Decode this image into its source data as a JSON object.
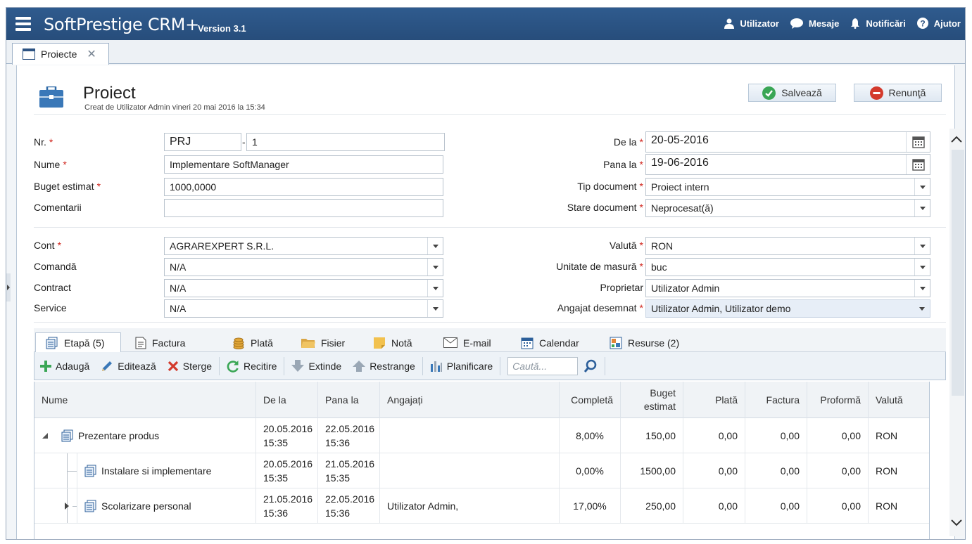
{
  "app": {
    "title": "SoftPrestige CRM+",
    "version": "Version 3.1"
  },
  "top_nav": [
    {
      "label": "Utilizator",
      "icon": "user-icon"
    },
    {
      "label": "Mesaje",
      "icon": "chat-icon"
    },
    {
      "label": "Notificări",
      "icon": "bell-icon"
    },
    {
      "label": "Ajutor",
      "icon": "help-icon"
    }
  ],
  "doc_tab": {
    "label": "Proiecte",
    "close": "✕"
  },
  "form": {
    "title": "Proiect",
    "subtitle": "Creat de Utilizator Admin vineri 20 mai 2016 la 15:34",
    "save": "Salvează",
    "cancel": "Renunţă"
  },
  "fields": {
    "nr_label": "Nr.",
    "nr_prefix": "PRJ",
    "nr_dash": "-",
    "nr_value": "1",
    "nume_label": "Nume",
    "nume_value": "Implementare SoftManager",
    "buget_label": "Buget estimat",
    "buget_value": "1000,0000",
    "comentarii_label": "Comentarii",
    "comentarii_value": "",
    "dela_label": "De la",
    "dela_value": "20-05-2016",
    "panala_label": "Pana la",
    "panala_value": "19-06-2016",
    "tipdoc_label": "Tip document",
    "tipdoc_value": "Proiect intern",
    "staredoc_label": "Stare document",
    "staredoc_value": "Neprocesat(ă)",
    "cont_label": "Cont",
    "cont_value": "AGRAREXPERT S.R.L.",
    "comanda_label": "Comandă",
    "comanda_value": "N/A",
    "contract_label": "Contract",
    "contract_value": "N/A",
    "service_label": "Service",
    "service_value": "N/A",
    "valuta_label": "Valută",
    "valuta_value": "RON",
    "unitate_label": "Unitate de masură",
    "unitate_value": "buc",
    "proprietar_label": "Proprietar",
    "proprietar_value": "Utilizator Admin",
    "angajat_label": "Angajat desemnat",
    "angajat_value": "Utilizator Admin, Utilizator demo",
    "required_mark": "*"
  },
  "tabs": [
    {
      "label": "Etapă (5)",
      "icon": "stages-icon",
      "active": true
    },
    {
      "label": "Factura",
      "icon": "invoice-icon"
    },
    {
      "label": "Plată",
      "icon": "coins-icon"
    },
    {
      "label": "Fisier",
      "icon": "folder-icon"
    },
    {
      "label": "Notă",
      "icon": "note-icon"
    },
    {
      "label": "E-mail",
      "icon": "envelope-icon"
    },
    {
      "label": "Calendar",
      "icon": "calendar-icon"
    },
    {
      "label": "Resurse (2)",
      "icon": "resources-icon"
    }
  ],
  "toolbar": {
    "add": "Adaugă",
    "edit": "Editează",
    "delete": "Sterge",
    "reload": "Recitire",
    "expand": "Extinde",
    "collapse": "Restrange",
    "plan": "Planificare",
    "search_placeholder": "Caută..."
  },
  "grid": {
    "columns": [
      "Nume",
      "De la",
      "Pana la",
      "Angajați",
      "Completă",
      "Buget estimat",
      "Plată",
      "Factura",
      "Proformă",
      "Valută"
    ],
    "rows": [
      {
        "name": "Prezentare produs",
        "from_date": "20.05.2016",
        "from_time": "15:35",
        "to_date": "22.05.2016",
        "to_time": "15:36",
        "employees": "",
        "complete": "8,00%",
        "budget": "150,00",
        "payment": "0,00",
        "invoice": "0,00",
        "proforma": "0,00",
        "currency": "RON"
      },
      {
        "name": "Instalare si implementare",
        "from_date": "20.05.2016",
        "from_time": "15:35",
        "to_date": "21.05.2016",
        "to_time": "15:35",
        "employees": "",
        "complete": "0,00%",
        "budget": "1500,00",
        "payment": "0,00",
        "invoice": "0,00",
        "proforma": "0,00",
        "currency": "RON"
      },
      {
        "name": "Scolarizare personal",
        "from_date": "21.05.2016",
        "from_time": "15:36",
        "to_date": "22.05.2016",
        "to_time": "15:36",
        "employees": "Utilizator Admin,",
        "complete": "17,00%",
        "budget": "250,00",
        "payment": "0,00",
        "invoice": "0,00",
        "proforma": "0,00",
        "currency": "RON"
      }
    ]
  }
}
